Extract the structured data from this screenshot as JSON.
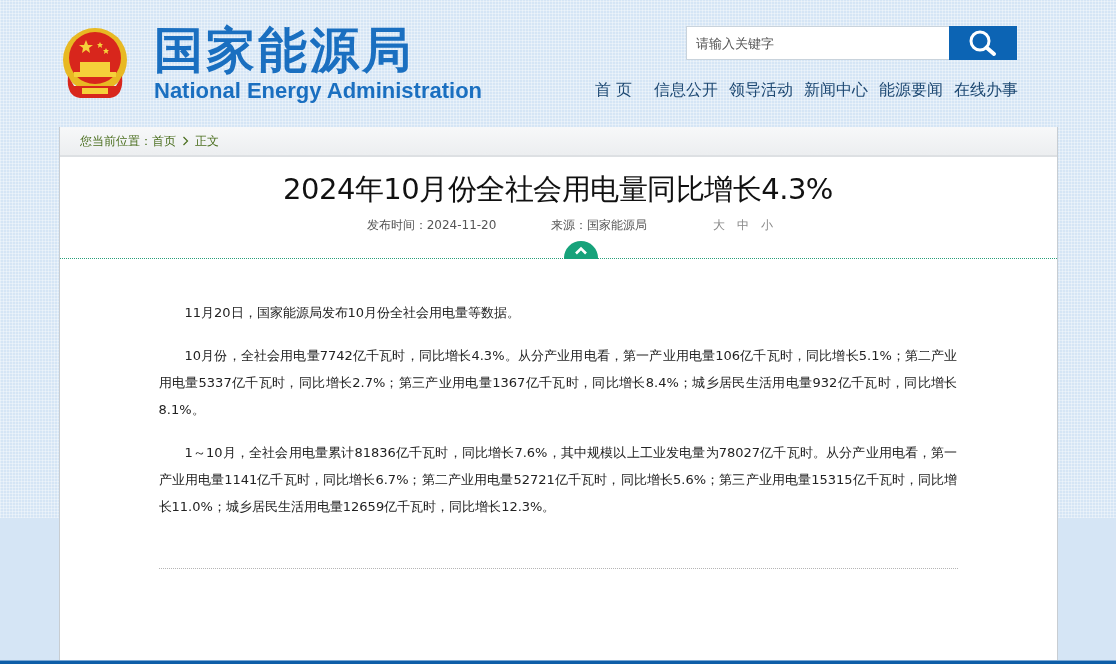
{
  "header": {
    "title_cn": "国家能源局",
    "title_en": "National Energy Administration",
    "search": {
      "placeholder": "请输入关键字"
    },
    "nav": [
      {
        "label": "首 页"
      },
      {
        "label": "信息公开"
      },
      {
        "label": "领导活动"
      },
      {
        "label": "新闻中心"
      },
      {
        "label": "能源要闻"
      },
      {
        "label": "在线办事"
      }
    ]
  },
  "breadcrumb": {
    "label": "您当前位置：",
    "items": [
      "首页",
      "正文"
    ]
  },
  "article": {
    "title": "2024年10月份全社会用电量同比增长4.3%",
    "date": "发布时间：2024-11-20",
    "source": "来源：国家能源局",
    "font_sizes": [
      "大",
      "中",
      "小"
    ],
    "paragraphs": [
      "11月20日，国家能源局发布10月份全社会用电量等数据。",
      "10月份，全社会用电量7742亿千瓦时，同比增长4.3%。从分产业用电看，第一产业用电量106亿千瓦时，同比增长5.1%；第二产业用电量5337亿千瓦时，同比增长2.7%；第三产业用电量1367亿千瓦时，同比增长8.4%；城乡居民生活用电量932亿千瓦时，同比增长8.1%。",
      "1～10月，全社会用电量累计81836亿千瓦时，同比增长7.6%，其中规模以上工业发电量为78027亿千瓦时。从分产业用电看，第一产业用电量1141亿千瓦时，同比增长6.7%；第二产业用电量52721亿千瓦时，同比增长5.6%；第三产业用电量15315亿千瓦时，同比增长11.0%；城乡居民生活用电量12659亿千瓦时，同比增长12.3%。"
    ]
  }
}
